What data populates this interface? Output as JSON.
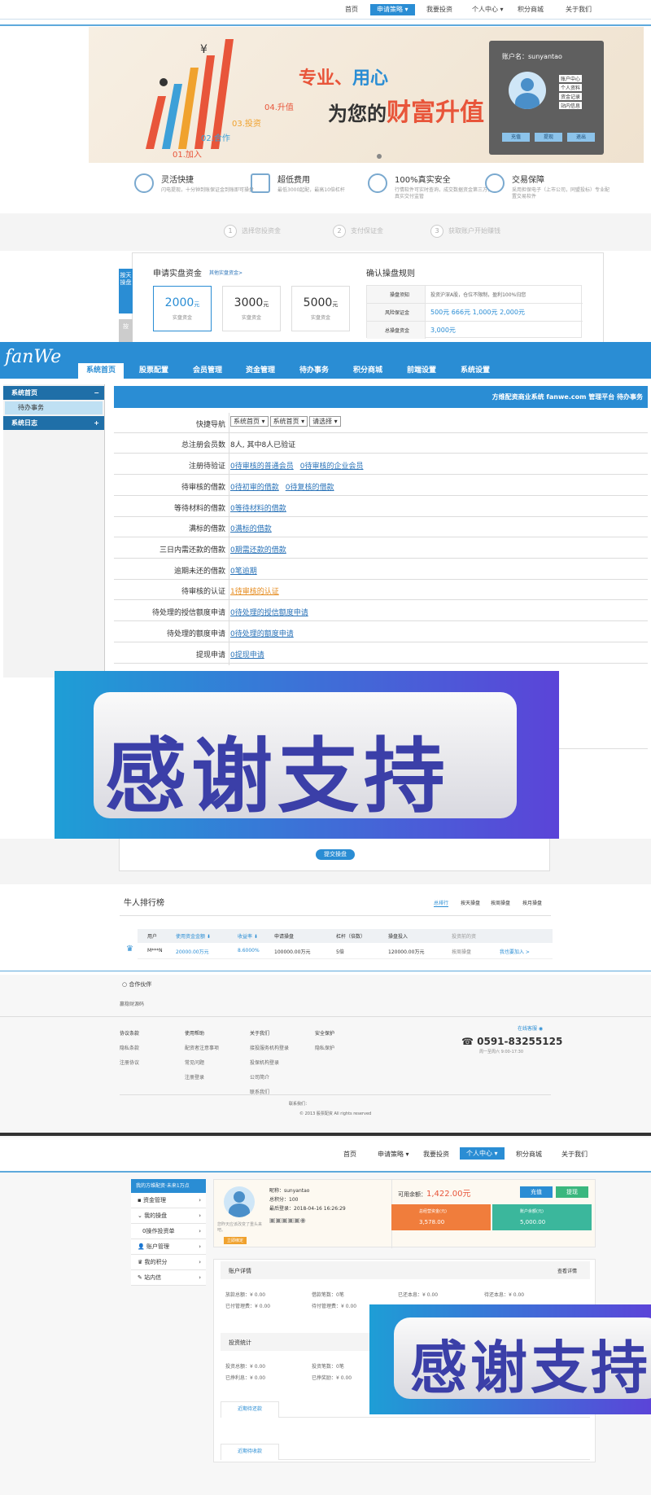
{
  "top_nav": {
    "items": [
      "首页",
      "申请策略",
      "我要投资",
      "个人中心",
      "积分商城",
      "关于我们"
    ],
    "active": "申请策略"
  },
  "banner": {
    "slogan1a": "专业、",
    "slogan1b": "用心",
    "slogan2a": "为您的",
    "slogan2b": "财富升值",
    "steps": [
      "01.加入",
      "02.合作",
      "03.投资",
      "04.升值"
    ],
    "login": {
      "account_label": "账户名：sunyantao",
      "links": [
        "账户中心",
        "个人资料",
        "资金记录",
        "站内信息"
      ],
      "buttons": [
        "充值",
        "提现",
        "退出"
      ]
    }
  },
  "features": [
    {
      "title": "灵活快捷",
      "desc": "闪电提现，十分钟到账保证金到账即可操盘"
    },
    {
      "title": "超低费用",
      "desc": "最低3000起配，最高10倍杠杆"
    },
    {
      "title": "100%真实安全",
      "desc": "行情软件可实时查询，成交数据资金第三方，真实交付监管"
    },
    {
      "title": "交易保障",
      "desc": "采用担保电子（上市公司，同盟投标）专业配置交易软件"
    }
  ],
  "steps": [
    {
      "n": "1",
      "label": "选择您投资金"
    },
    {
      "n": "2",
      "label": "支付保证金"
    },
    {
      "n": "3",
      "label": "获取账户开始赚钱"
    }
  ],
  "apply": {
    "side_tab": "按天操盘",
    "side_tab2": "按",
    "title": "申请实盘资金",
    "other_link": "其他实盘资金>",
    "amounts": [
      {
        "v": "2000",
        "u": "元",
        "desc": "实盘资金"
      },
      {
        "v": "3000",
        "u": "元",
        "desc": "实盘资金"
      },
      {
        "v": "5000",
        "u": "元",
        "desc": "实盘资金"
      }
    ],
    "rule_title": "确认操盘规则",
    "rules": [
      {
        "k": "操盘须知",
        "v": "投资沪深A股，仓位不限制，盈利100%归您"
      },
      {
        "k": "风险保证金",
        "v": "500元  666元  1,000元  2,000元"
      },
      {
        "k": "总操盘资金",
        "v": "3,000元"
      }
    ]
  },
  "admin": {
    "logo": "fanWe",
    "tabs": [
      "系统首页",
      "股票配置",
      "会员管理",
      "资金管理",
      "待办事务",
      "积分商城",
      "前端设置",
      "系统设置"
    ],
    "active_tab": "系统首页",
    "menu": [
      {
        "title": "系统首页",
        "sign": "−"
      },
      {
        "item": "待办事务"
      },
      {
        "title": "系统日志",
        "sign": "+"
      }
    ],
    "header": "方维配资商业系统 fanwe.com 管理平台 待办事务",
    "quick_nav_label": "快捷导航",
    "quick_nav_selects": [
      "系统首页 ▾",
      "系统首页 ▾",
      "请选择 ▾"
    ],
    "rows": [
      {
        "k": "总注册会员数",
        "v": "8人, 其中8人已验证",
        "links": []
      },
      {
        "k": "注册待验证",
        "v": "",
        "links": [
          "0待审核的普通会员",
          "0待审核的企业会员"
        ]
      },
      {
        "k": "待审核的借款",
        "v": "",
        "links": [
          "0待初审的借款",
          "0待复核的借款"
        ]
      },
      {
        "k": "等待材料的借款",
        "v": "",
        "links": [
          "0等待材料的借款"
        ]
      },
      {
        "k": "满标的借款",
        "v": "",
        "links": [
          "0满标的借款"
        ]
      },
      {
        "k": "三日内需还款的借款",
        "v": "",
        "links": [
          "0期需还款的借款"
        ]
      },
      {
        "k": "逾期未还的借款",
        "v": "",
        "links": [
          "0笔逾期"
        ]
      },
      {
        "k": "待审核的认证",
        "v": "",
        "links": [
          "1待审核的认证"
        ],
        "orange": true
      },
      {
        "k": "待处理的授信额度申请",
        "v": "",
        "links": [
          "0待处理的授信额度申请"
        ]
      },
      {
        "k": "待处理的额度申请",
        "v": "",
        "links": [
          "0待处理的额度申请"
        ]
      },
      {
        "k": "提现申请",
        "v": "",
        "links": [
          "0提现申请"
        ]
      }
    ]
  },
  "thanks_text": "感谢支持",
  "submit_button": "提交操盘",
  "ranking": {
    "title": "牛人排行榜",
    "tabs": [
      "总排行",
      "按天操盘",
      "按周操盘",
      "按月操盘"
    ],
    "headers": [
      "用户",
      "使用资金金额 ⬇",
      "收益率 ⬇",
      "申请操盘",
      "杠杆（倍数）",
      "操盘投入",
      "投资前的资"
    ],
    "row": {
      "user": "M***N",
      "fund": "20000.00万元",
      "rate": "8.6000%",
      "apply": "100000.00万元",
      "lever": "5倍",
      "invest": "120000.00万元",
      "action1": "按周操盘",
      "action2": "我也要加入 >"
    }
  },
  "partner": {
    "title": "合作伙伴",
    "sub": "赢稳财源码"
  },
  "footer": {
    "cols": [
      {
        "h": "协议条款",
        "items": [
          "隐私条款",
          "注册协议"
        ]
      },
      {
        "h": "使用帮助",
        "items": [
          "配资者注意事项",
          "常见问题",
          "注册登录"
        ]
      },
      {
        "h": "关于我们",
        "items": [
          "接投服务机构登录",
          "投保机构登录",
          "公司简介",
          "联系我们"
        ]
      },
      {
        "h": "安全保护",
        "items": [
          "隐私保护"
        ]
      }
    ],
    "online": "在线客服",
    "phone": "0591-83255125",
    "hours": "周一至周六 9:00-17:30",
    "contact": "联系我们：",
    "copyright": "© 2013 股票配资 All rights reserved"
  },
  "uc_nav": {
    "items": [
      "首页",
      "申请策略",
      "我要投资",
      "个人中心",
      "积分商城",
      "关于我们"
    ],
    "active": "个人中心"
  },
  "uc": {
    "side_header": "我的方维配资·未来1万点",
    "side_items": [
      "资金管理",
      "我的操盘",
      "0操作投资单",
      "账户管理",
      "我的积分",
      "站内信"
    ],
    "nickname": "昵称：sunyantao",
    "points": "总积分：100",
    "last_login": "最后登录：2018-04-16 16:26:29",
    "motto": "您昨天应该改变了重头来吧。",
    "verify": "立即绑定",
    "balance_label": "可用余额：",
    "balance": "1,422.00元",
    "btn_recharge": "充值",
    "btn_withdraw": "提现",
    "card1_label": "总经营资金(元)",
    "card1_value": "3,578.00",
    "card2_label": "账户余额(元)",
    "card2_value": "5,000.00",
    "detail_title": "账户详情",
    "detail_more": "查看详情",
    "detail": [
      [
        "放款总额：¥ 0.00",
        "借款笔数：0笔",
        "已还本息：¥ 0.00",
        "待还本息：¥ 0.00"
      ],
      [
        "已付管理费：¥ 0.00",
        "待付管理费：¥ 0.00"
      ]
    ],
    "invest_title": "投资统计",
    "invest": [
      [
        "投资总额：¥ 0.00",
        "投资笔数：0笔"
      ],
      [
        "已挣利息：¥ 0.00",
        "已挣奖励：¥ 0.00"
      ]
    ],
    "tab1": "近期待还款",
    "tab2": "近期待收款"
  }
}
